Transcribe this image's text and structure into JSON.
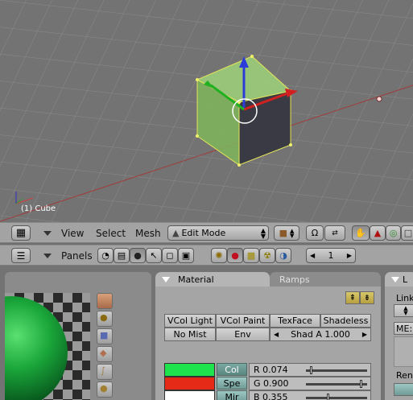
{
  "viewport": {
    "object_label": "(1) Cube"
  },
  "header3d": {
    "menus": [
      "View",
      "Select",
      "Mesh"
    ],
    "mode": "Edit Mode",
    "mode_icon": "triangle-icon"
  },
  "buttons_header": {
    "panels_label": "Panels",
    "frame": "1"
  },
  "material": {
    "tabs": [
      "Material",
      "Ramps"
    ],
    "right_tab_label": "L",
    "toggles_row1": [
      "VCol Light",
      "VCol Paint",
      "TexFace",
      "Shadeless"
    ],
    "toggles_row2_a": "No Mist",
    "toggles_row2_b": "Env",
    "shading": "Shad A 1.000",
    "color_buttons": [
      "Col",
      "Spe",
      "Mir"
    ],
    "sliders": [
      {
        "label": "R 0.074",
        "value": 0.074
      },
      {
        "label": "G 0.900",
        "value": 0.9
      },
      {
        "label": "B 0.355",
        "value": 0.355
      }
    ],
    "swatch_colors": [
      "#1fe34c",
      "#e62a18",
      "#ffffff"
    ],
    "link_panel": {
      "link_label": "Link",
      "me_label": "ME:",
      "ren_label": "Ren"
    }
  }
}
